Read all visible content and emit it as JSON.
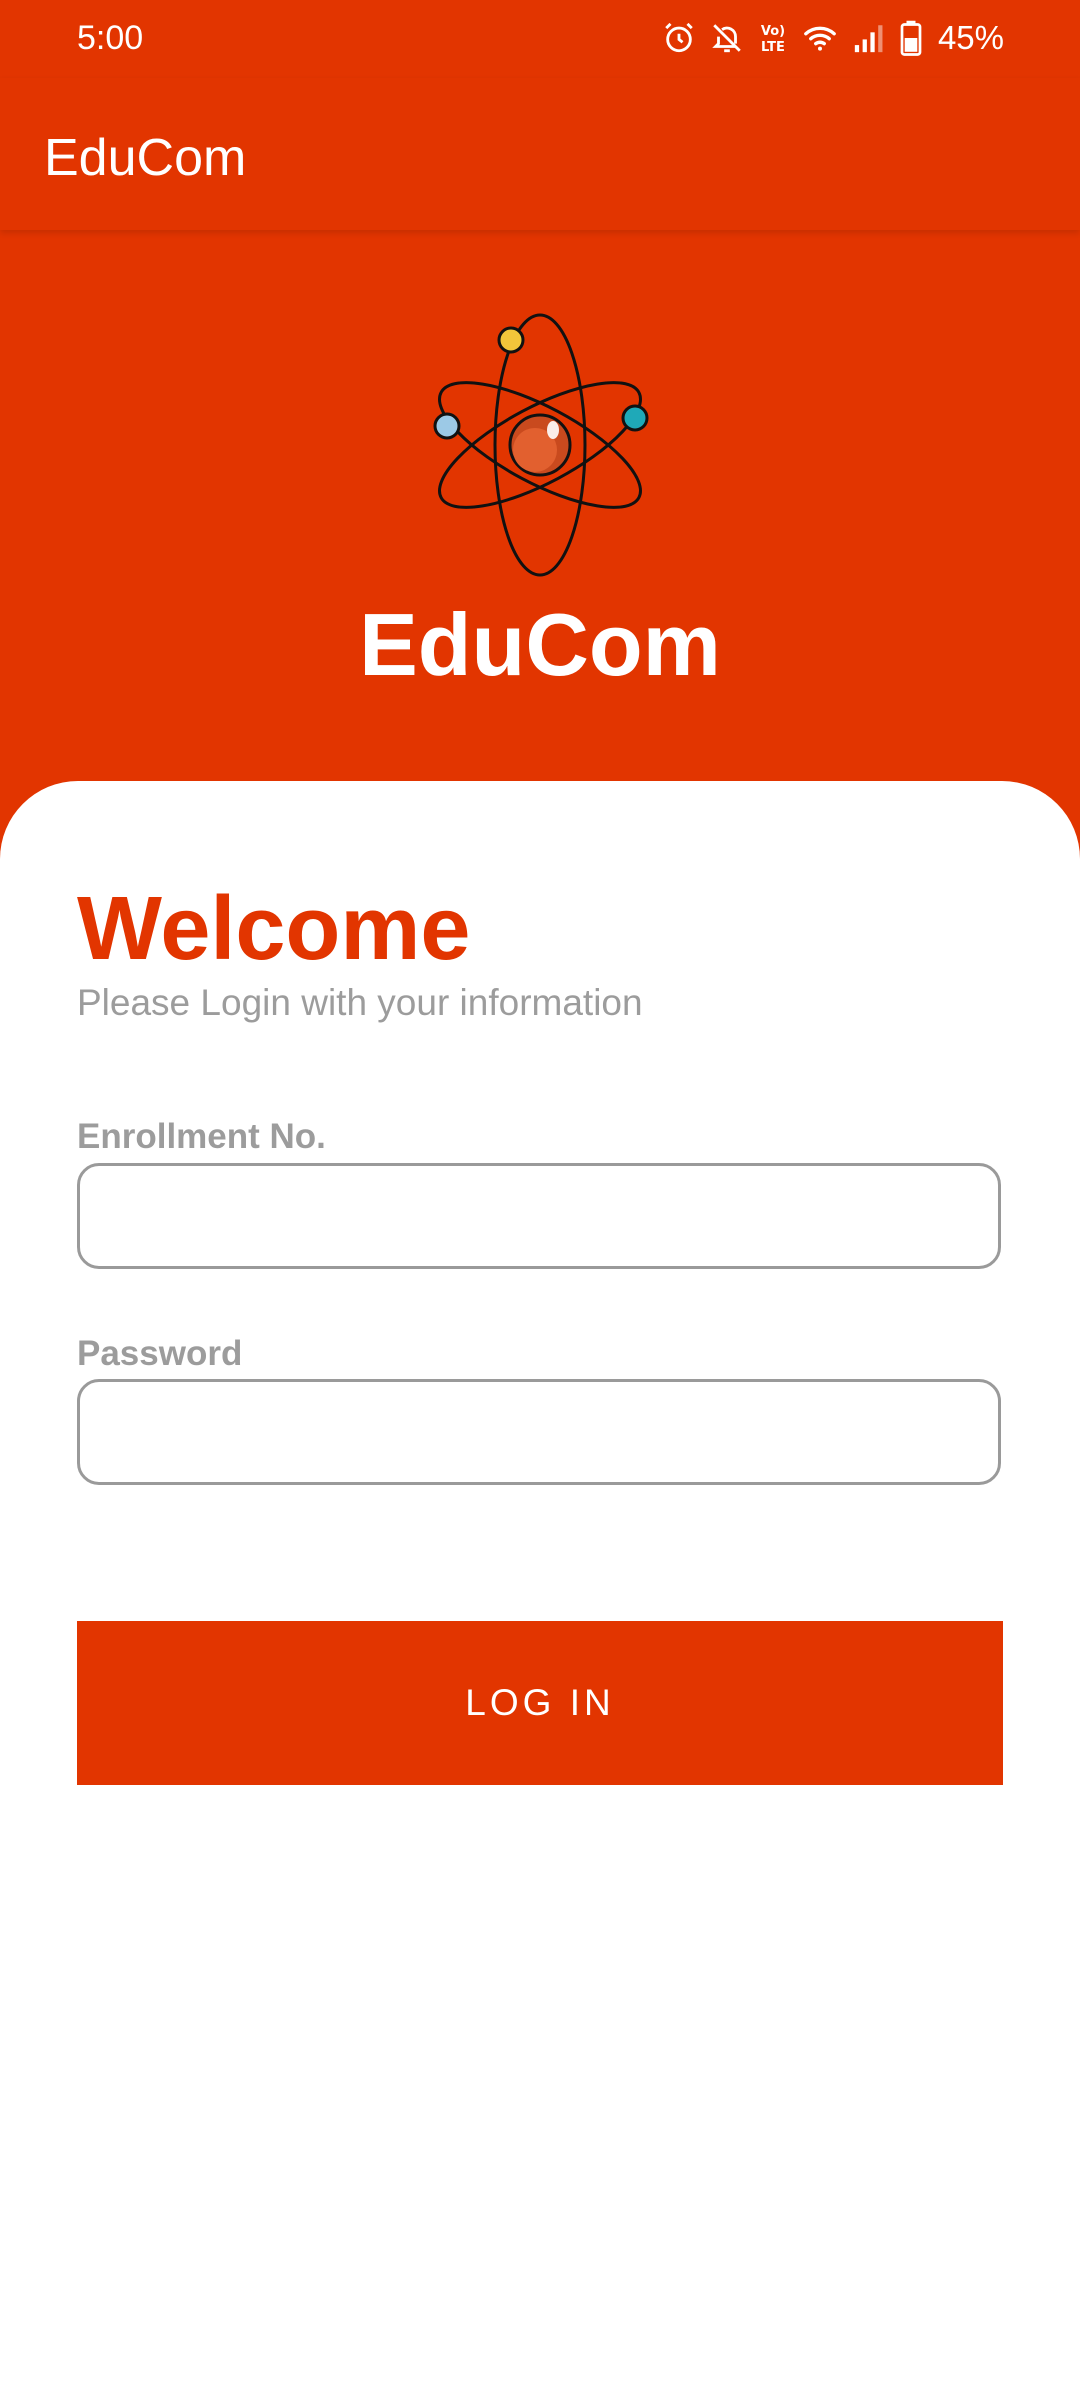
{
  "status_bar": {
    "time": "5:00",
    "battery": "45%",
    "icons": [
      "alarm-icon",
      "notifications-off-icon",
      "volte-icon",
      "wifi-icon",
      "signal-icon",
      "battery-icon"
    ]
  },
  "app_bar": {
    "title": "EduCom"
  },
  "header": {
    "logo": "atom-icon",
    "brand": "EduCom"
  },
  "login": {
    "heading": "Welcome",
    "subtitle": "Please Login with your information",
    "enrollment_label": "Enrollment No.",
    "enrollment_value": "",
    "password_label": "Password",
    "password_value": "",
    "button_label": "LOG IN"
  },
  "colors": {
    "primary": "#E23500",
    "label": "#9C9C9C",
    "background": "#FFFFFF"
  }
}
